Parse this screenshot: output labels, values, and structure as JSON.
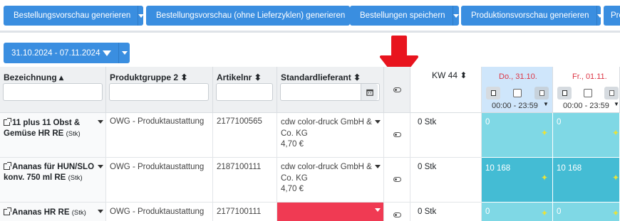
{
  "toolbar": {
    "buttons": [
      {
        "label": "Bestellungsvorschau generieren"
      },
      {
        "label": "Bestellungsvorschau (ohne Lieferzyklen) generieren"
      },
      {
        "label": "Bestellungen speichern"
      },
      {
        "label": "Produktionsvorschau generieren"
      },
      {
        "label": "Pro"
      }
    ]
  },
  "date_filter": {
    "label": "31.10.2024 - 07.11.2024"
  },
  "columns": {
    "bezeichnung": "Bezeichnung",
    "produktgruppe": "Produktgruppe 2",
    "artikelnr": "Artikelnr",
    "lieferant": "Standardlieferant",
    "kw": "KW 44"
  },
  "days": [
    {
      "label": "Do., 31.10.",
      "time": "00:00 - 23:59"
    },
    {
      "label": "Fr., 01.11.",
      "time": "00:00 - 23:59"
    }
  ],
  "rows": [
    {
      "name_line1": "11 plus 11 Obst &",
      "name_line2": "Gemüse HR RE",
      "unit": "(Stk)",
      "group": "OWG - Produktaustattung",
      "artnr": "2177100565",
      "supplier_line1": "cdw color-druck GmbH &",
      "supplier_line2": "Co. KG",
      "price": "4,70 €",
      "kw": "0 Stk",
      "day1": "0",
      "day2": "0"
    },
    {
      "name_line1": "Ananas für HUN/SLO",
      "name_line2": "konv. 750 ml RE",
      "unit": "(Stk)",
      "group": "OWG - Produktaustattung",
      "artnr": "2187100111",
      "supplier_line1": "cdw color-druck GmbH &",
      "supplier_line2": "Co. KG",
      "price": "4,70 €",
      "kw": "0 Stk",
      "day1": "10 168",
      "day2": "10 168"
    },
    {
      "name_line1": "Ananas HR RE",
      "name_line2": "",
      "unit": "(Stk)",
      "group": "OWG - Produktaustattung",
      "artnr": "2177100111",
      "supplier_line1": "",
      "supplier_line2": "",
      "price": "",
      "kw": "0 Stk",
      "day1": "0",
      "day2": "0"
    }
  ],
  "colors": {
    "accent": "#3a8ee0",
    "day_cell": "#7fd8e5",
    "day_cell_strong": "#44bcd4",
    "missing": "#f03a53",
    "arrow": "#e8141e"
  }
}
